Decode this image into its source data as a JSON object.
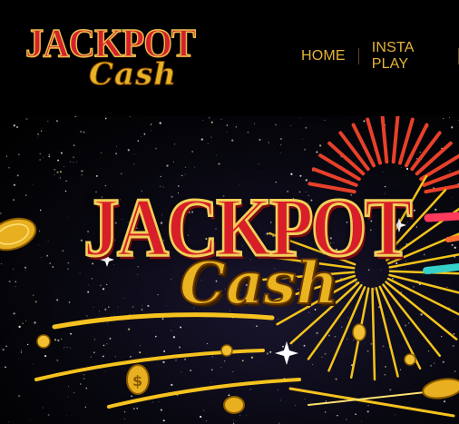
{
  "header": {
    "logo": {
      "line1": "JACKPOT",
      "line2": "Cash"
    },
    "nav": [
      {
        "label": "HOME"
      },
      {
        "label": "INSTA PLAY"
      }
    ]
  },
  "hero": {
    "title_line1": "JACKPOT",
    "title_line2": "Cash"
  },
  "colors": {
    "background": "#000000",
    "nav_text": "#e5b43a",
    "logo_red": "#d6212b",
    "logo_gold": "#e6b325"
  },
  "icons": [
    "gold-coin-icon",
    "firework-burst"
  ]
}
